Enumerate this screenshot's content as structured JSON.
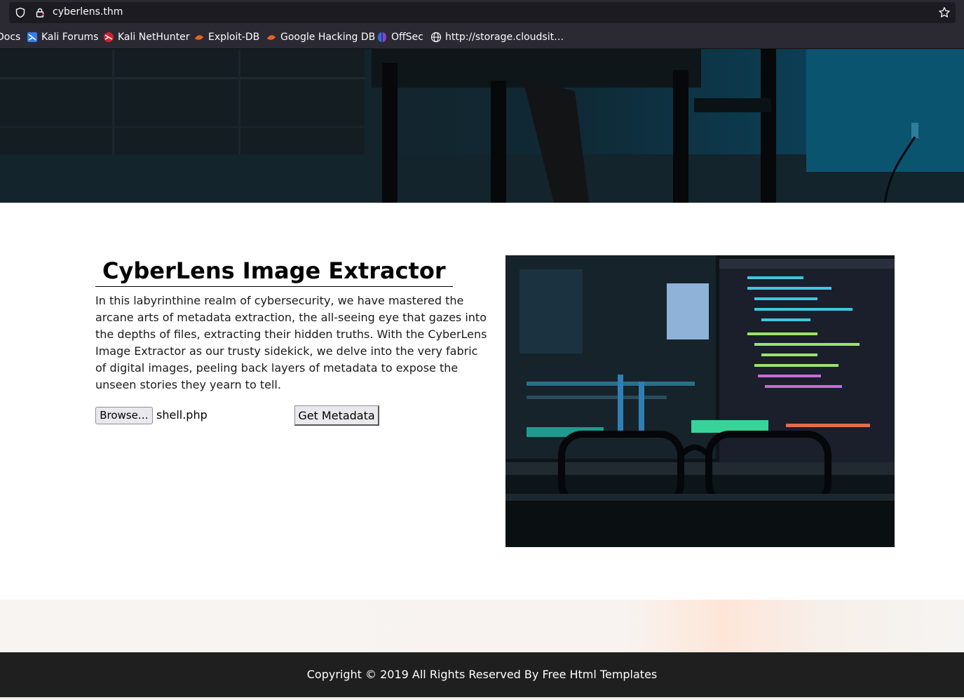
{
  "browser": {
    "url": "cyberlens.thm",
    "bookmarks": [
      {
        "label": "Docs",
        "icon": "doc-icon"
      },
      {
        "label": "Kali Forums",
        "icon": "kali-icon"
      },
      {
        "label": "Kali NetHunter",
        "icon": "nethunter-icon"
      },
      {
        "label": "Exploit-DB",
        "icon": "exploitdb-icon"
      },
      {
        "label": "Google Hacking DB",
        "icon": "exploitdb-icon"
      },
      {
        "label": "OffSec",
        "icon": "offsec-icon"
      },
      {
        "label": "http://storage.cloudsit…",
        "icon": "globe-icon"
      }
    ]
  },
  "main": {
    "title": "CyberLens Image Extractor",
    "description": "In this labyrinthine realm of cybersecurity, we have mastered the arcane arts of metadata extraction, the all-seeing eye that gazes into the depths of files, extracting their hidden truths. With the CyberLens Image Extractor as our trusty sidekick, we delve into the very fabric of digital images, peeling back layers of metadata to expose the unseen stories they yearn to tell.",
    "form": {
      "browse_label": "Browse…",
      "file_name": "shell.php",
      "submit_label": "Get Metadata"
    }
  },
  "footer": {
    "copyright": "Copyright © 2019 All Rights Reserved By Free Html Templates"
  },
  "colors": {
    "chrome_bg": "#2b2a33",
    "urlbar_bg": "#1c1b22",
    "footer_bg": "#1f1f1f",
    "button_bg": "#e9e9ed"
  }
}
